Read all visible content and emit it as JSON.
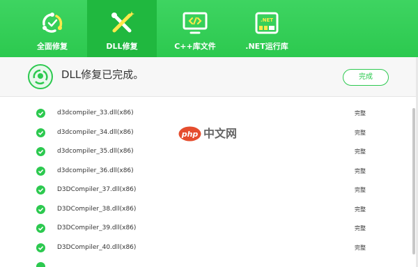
{
  "tabs": [
    {
      "label": "全面修复",
      "icon": "refresh-repair-icon",
      "active": false
    },
    {
      "label": "DLL修复",
      "icon": "tools-icon",
      "active": true
    },
    {
      "label": "C++库文件",
      "icon": "code-monitor-icon",
      "active": false
    },
    {
      "label": ".NET运行库",
      "icon": "net-window-icon",
      "active": false
    }
  ],
  "tab_net_badge": ".NET",
  "status": {
    "message": "DLL修复已完成。",
    "button_label": "完成",
    "icon": "repair-status-icon"
  },
  "files": [
    {
      "name": "d3dcompiler_33.dll(x86)",
      "status": "完整"
    },
    {
      "name": "d3dcompiler_34.dll(x86)",
      "status": "完整"
    },
    {
      "name": "d3dcompiler_35.dll(x86)",
      "status": "完整"
    },
    {
      "name": "d3dcompiler_36.dll(x86)",
      "status": "完整"
    },
    {
      "name": "D3DCompiler_37.dll(x86)",
      "status": "完整"
    },
    {
      "name": "D3DCompiler_38.dll(x86)",
      "status": "完整"
    },
    {
      "name": "D3DCompiler_39.dll(x86)",
      "status": "完整"
    },
    {
      "name": "D3DCompiler_40.dll(x86)",
      "status": "完整"
    }
  ],
  "watermark": {
    "logo_text": "php",
    "text": "中文网"
  },
  "colors": {
    "brand_green": "#2cc94f",
    "active_tab": "#20b83f",
    "check_green": "#2cc94f"
  }
}
